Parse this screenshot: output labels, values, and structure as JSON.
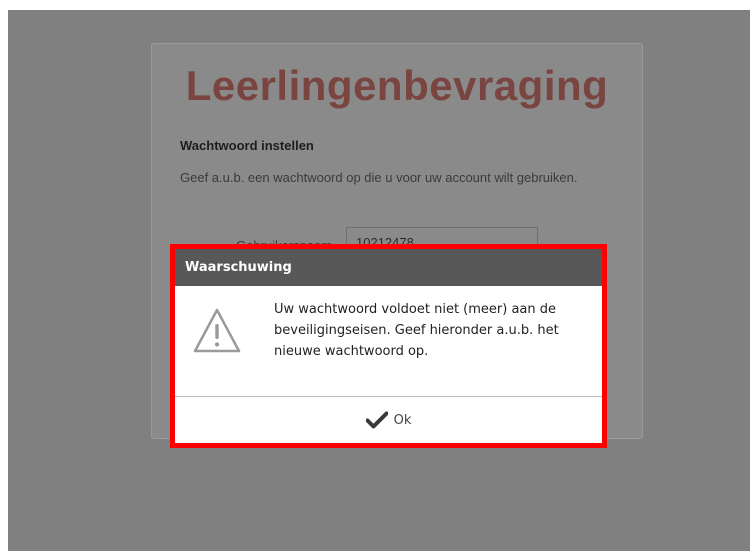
{
  "page": {
    "app_title": "Leerlingenbevraging",
    "section_heading": "Wachtwoord instellen",
    "section_text": "Geef a.u.b. een wachtwoord op die u voor uw account wilt gebruiken.",
    "username_label": "Gebruikersnaam",
    "username_value": "10212478"
  },
  "dialog": {
    "title": "Waarschuwing",
    "icon": "warning-triangle-icon",
    "message": "Uw wachtwoord voldoet niet (meer) aan de beveiligingseisen. Geef hieronder a.u.b. het nieuwe wachtwoord op.",
    "ok_icon": "checkmark-icon",
    "ok_label": "Ok"
  },
  "colors": {
    "overlay": "#808080",
    "title_color": "#7a4540",
    "dialog_header": "#585858",
    "highlight_border": "#ff0000"
  }
}
